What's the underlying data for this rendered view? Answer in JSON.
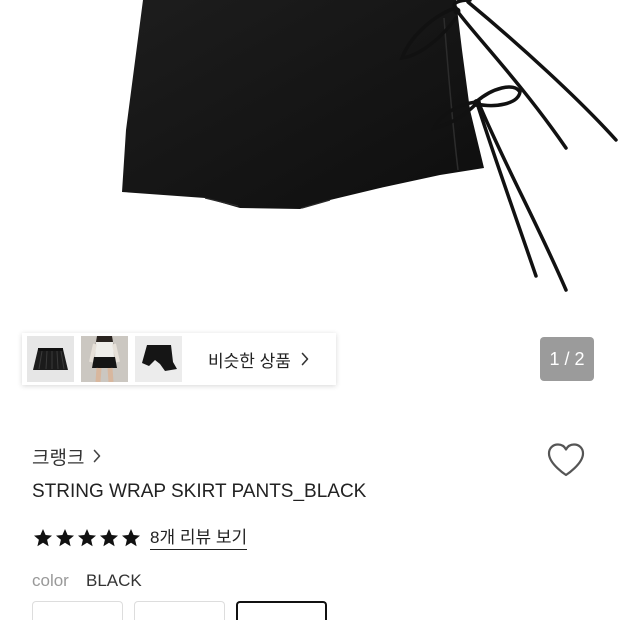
{
  "gallery": {
    "page_indicator": "1 / 2",
    "similar_products_label": "비슷한 상품"
  },
  "brand": {
    "name": "크랭크"
  },
  "product": {
    "title": "STRING WRAP SKIRT PANTS_BLACK"
  },
  "rating": {
    "value": 5,
    "max": 5,
    "review_link": "8개 리뷰 보기"
  },
  "color": {
    "label": "color",
    "value": "BLACK"
  },
  "options": [
    {
      "selected": false
    },
    {
      "selected": false
    },
    {
      "selected": true
    }
  ],
  "icons": {
    "brand_chevron": "chevron-right-icon",
    "similar_chevron": "chevron-right-icon",
    "wishlist": "heart-outline-icon",
    "star": "star-filled-icon"
  },
  "colors": {
    "text_primary": "#222222",
    "text_muted": "#999999",
    "indicator_bg": "#9b9b9b",
    "selected_border": "#111111",
    "option_border": "#dddddd",
    "star_fill": "#111111"
  }
}
